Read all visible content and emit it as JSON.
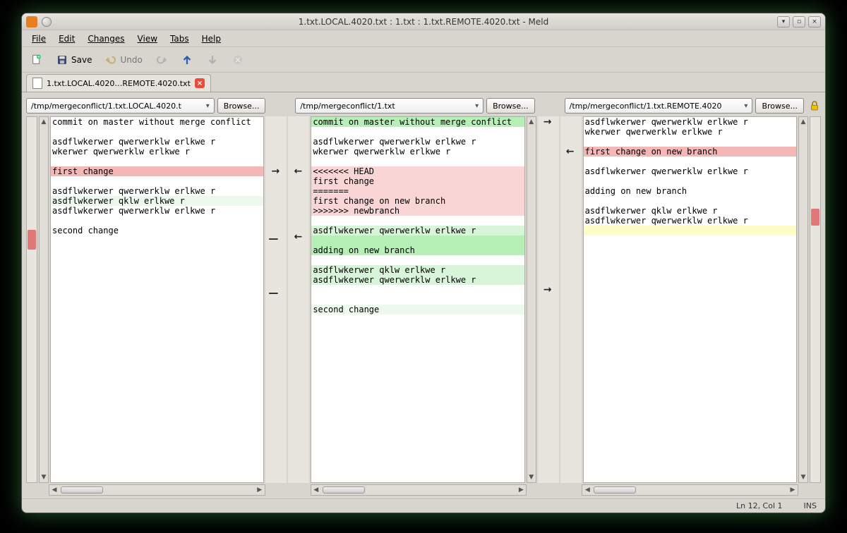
{
  "title": "1.txt.LOCAL.4020.txt : 1.txt : 1.txt.REMOTE.4020.txt - Meld",
  "menu": {
    "file": "File",
    "edit": "Edit",
    "changes": "Changes",
    "view": "View",
    "tabs": "Tabs",
    "help": "Help"
  },
  "toolbar": {
    "save": "Save",
    "undo": "Undo"
  },
  "tab": {
    "label": "1.txt.LOCAL.4020…REMOTE.4020.txt"
  },
  "browse": "Browse...",
  "paths": {
    "left": "/tmp/mergeconflict/1.txt.LOCAL.4020.t",
    "mid": "/tmp/mergeconflict/1.txt",
    "right": "/tmp/mergeconflict/1.txt.REMOTE.4020"
  },
  "left_lines": [
    {
      "t": "commit on master without merge conflict",
      "c": ""
    },
    {
      "t": "",
      "c": ""
    },
    {
      "t": "asdflwkerwer qwerwerklw erlkwe r",
      "c": ""
    },
    {
      "t": "wkerwer qwerwerklw erlkwe r",
      "c": ""
    },
    {
      "t": "",
      "c": ""
    },
    {
      "t": "first change",
      "c": "bg-red"
    },
    {
      "t": "",
      "c": ""
    },
    {
      "t": "asdflwkerwer qwerwerklw erlkwe r",
      "c": ""
    },
    {
      "t": "asdflwkerwer qklw erlkwe r",
      "c": "bg-vlgreen"
    },
    {
      "t": "asdflwkerwer qwerwerklw erlkwe r",
      "c": ""
    },
    {
      "t": "",
      "c": ""
    },
    {
      "t": "second change",
      "c": ""
    }
  ],
  "mid_lines": [
    {
      "t": "commit on master without merge conflict",
      "c": "bg-green"
    },
    {
      "t": "",
      "c": ""
    },
    {
      "t": "asdflwkerwer qwerwerklw erlkwe r",
      "c": ""
    },
    {
      "t": "wkerwer qwerwerklw erlkwe r",
      "c": ""
    },
    {
      "t": "",
      "c": ""
    },
    {
      "t": "<<<<<<< HEAD",
      "c": "bg-lred"
    },
    {
      "t": "first change",
      "c": "bg-lred"
    },
    {
      "t": "=======",
      "c": "bg-lred"
    },
    {
      "t": "first change on new branch",
      "c": "bg-lred"
    },
    {
      "t": ">>>>>>> newbranch",
      "c": "bg-lred"
    },
    {
      "t": "",
      "c": ""
    },
    {
      "t": "asdflwkerwer qwerwerklw erlkwe r",
      "c": "bg-lgreen"
    },
    {
      "t": "",
      "c": "bg-green"
    },
    {
      "t": "adding on new branch",
      "c": "bg-green"
    },
    {
      "t": "",
      "c": ""
    },
    {
      "t": "asdflwkerwer qklw erlkwe r",
      "c": "bg-lgreen"
    },
    {
      "t": "asdflwkerwer qwerwerklw erlkwe r",
      "c": "bg-lgreen"
    },
    {
      "t": "",
      "c": ""
    },
    {
      "t": "",
      "c": ""
    },
    {
      "t": "second change",
      "c": "bg-vlgreen"
    }
  ],
  "right_lines": [
    {
      "t": "asdflwkerwer qwerwerklw erlkwe r",
      "c": ""
    },
    {
      "t": "wkerwer qwerwerklw erlkwe r",
      "c": ""
    },
    {
      "t": "",
      "c": ""
    },
    {
      "t": "first change on new branch",
      "c": "bg-red"
    },
    {
      "t": "",
      "c": ""
    },
    {
      "t": "asdflwkerwer qwerwerklw erlkwe r",
      "c": ""
    },
    {
      "t": "",
      "c": ""
    },
    {
      "t": "adding on new branch",
      "c": ""
    },
    {
      "t": "",
      "c": ""
    },
    {
      "t": "asdflwkerwer qklw erlkwe r",
      "c": ""
    },
    {
      "t": "asdflwkerwer qwerwerklw erlkwe r",
      "c": ""
    },
    {
      "t": "",
      "c": "bg-yellow"
    }
  ],
  "status": {
    "pos": "Ln 12, Col 1",
    "mode": "INS"
  }
}
